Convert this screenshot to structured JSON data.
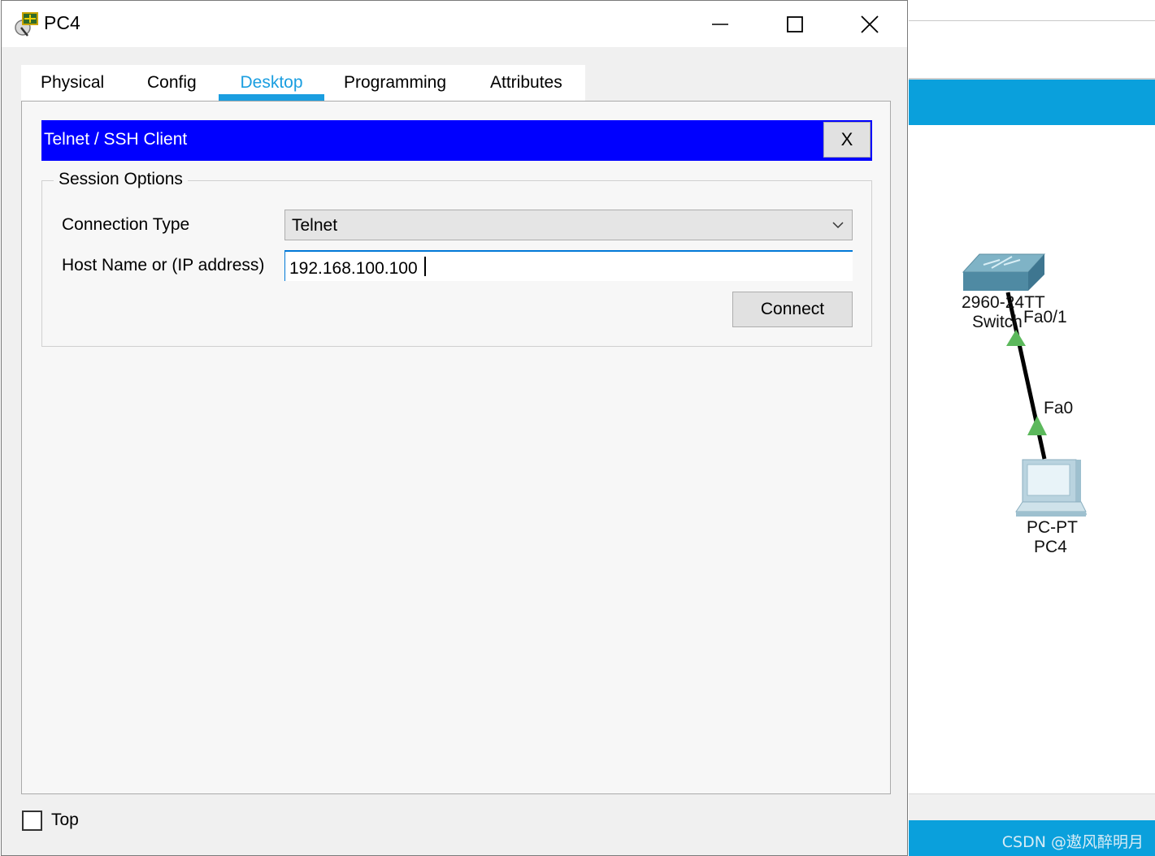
{
  "window": {
    "title": "PC4"
  },
  "tabs": [
    {
      "label": "Physical",
      "active": false
    },
    {
      "label": "Config",
      "active": false
    },
    {
      "label": "Desktop",
      "active": true
    },
    {
      "label": "Programming",
      "active": false
    },
    {
      "label": "Attributes",
      "active": false
    }
  ],
  "panel": {
    "title": "Telnet / SSH Client",
    "close_label": "X"
  },
  "session": {
    "legend": "Session Options",
    "connection_type_label": "Connection Type",
    "connection_type_value": "Telnet",
    "host_label": "Host Name or (IP address)",
    "host_value": "192.168.100.100",
    "connect_label": "Connect"
  },
  "footer": {
    "top_label": "Top",
    "top_checked": false
  },
  "topology": {
    "switch_label_line1": "2960-24TT",
    "switch_label_line2": "Switch",
    "switch_port": "Fa0/1",
    "pc_port": "Fa0",
    "pc_label_line1": "PC-PT",
    "pc_label_line2": "PC4",
    "link_up_color": "#5cb85c"
  },
  "watermark": "CSDN @遨风醉明月",
  "colors": {
    "accent": "#1a9ee0",
    "panel_header": "#0000ff",
    "workspace_band": "#0aa0dc"
  }
}
